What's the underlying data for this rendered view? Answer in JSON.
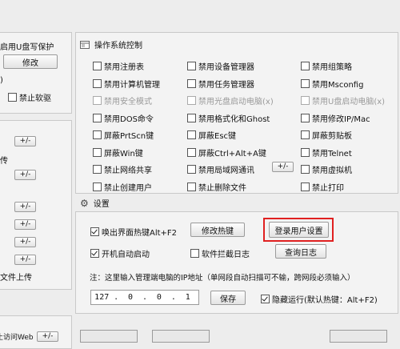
{
  "left": {
    "usb_protect": "启用U盘写保护",
    "modify_label": "修改",
    "paren": ")",
    "disable_soft_keyboard": "禁止软驱",
    "pm": "+/-",
    "chuan": "传",
    "file_upload": "文件上传",
    "partial_text": "禁止访问Web"
  },
  "os_control": {
    "title": "操作系统控制",
    "items": [
      {
        "label": "禁用注册表",
        "checked": false,
        "disabled": false
      },
      {
        "label": "禁用设备管理器",
        "checked": false,
        "disabled": false
      },
      {
        "label": "禁用组策略",
        "checked": false,
        "disabled": false
      },
      {
        "label": "禁用计算机管理",
        "checked": false,
        "disabled": false
      },
      {
        "label": "禁用任务管理器",
        "checked": false,
        "disabled": false
      },
      {
        "label": "禁用Msconfig",
        "checked": false,
        "disabled": false
      },
      {
        "label": "禁用安全模式",
        "checked": false,
        "disabled": true
      },
      {
        "label": "禁用光盘启动电脑(x)",
        "checked": false,
        "disabled": true
      },
      {
        "label": "禁用U盘启动电脑(x)",
        "checked": false,
        "disabled": true
      },
      {
        "label": "禁用DOS命令",
        "checked": false,
        "disabled": false
      },
      {
        "label": "禁用格式化和Ghost",
        "checked": false,
        "disabled": false
      },
      {
        "label": "禁用修改IP/Mac",
        "checked": false,
        "disabled": false
      },
      {
        "label": "屏蔽PrtScn键",
        "checked": false,
        "disabled": false
      },
      {
        "label": "屏蔽Esc键",
        "checked": false,
        "disabled": false
      },
      {
        "label": "屏蔽剪贴板",
        "checked": false,
        "disabled": false
      },
      {
        "label": "屏蔽Win键",
        "checked": false,
        "disabled": false
      },
      {
        "label": "屏蔽Ctrl+Alt+A键",
        "checked": false,
        "disabled": false
      },
      {
        "label": "禁用Telnet",
        "checked": false,
        "disabled": false
      },
      {
        "label": "禁止网络共享",
        "checked": false,
        "disabled": false
      },
      {
        "label": "禁用局域网通讯",
        "checked": false,
        "disabled": false
      },
      {
        "label": "禁用虚拟机",
        "checked": false,
        "disabled": false
      },
      {
        "label": "禁止创建用户",
        "checked": false,
        "disabled": false
      },
      {
        "label": "禁止删除文件",
        "checked": false,
        "disabled": false
      },
      {
        "label": "禁止打印",
        "checked": false,
        "disabled": false
      }
    ],
    "lan_pm": "+/-"
  },
  "settings": {
    "title": "设置",
    "hotkey_cb": "唤出界面热键Alt+F2",
    "modify_hotkey": "修改热键",
    "login_settings": "登录用户设置",
    "autostart": "开机自动启动",
    "software_log": "软件拦截日志",
    "query_log": "查询日志",
    "note": "注：这里输入管理端电脑的IP地址（单网段自动扫描可不输，跨网段必须输入）",
    "ip": [
      "127",
      "0",
      "0",
      "1"
    ],
    "save": "保存",
    "hidden_run": "隐藏运行(默认热键：Alt+F2)"
  },
  "accent": "#e02020"
}
